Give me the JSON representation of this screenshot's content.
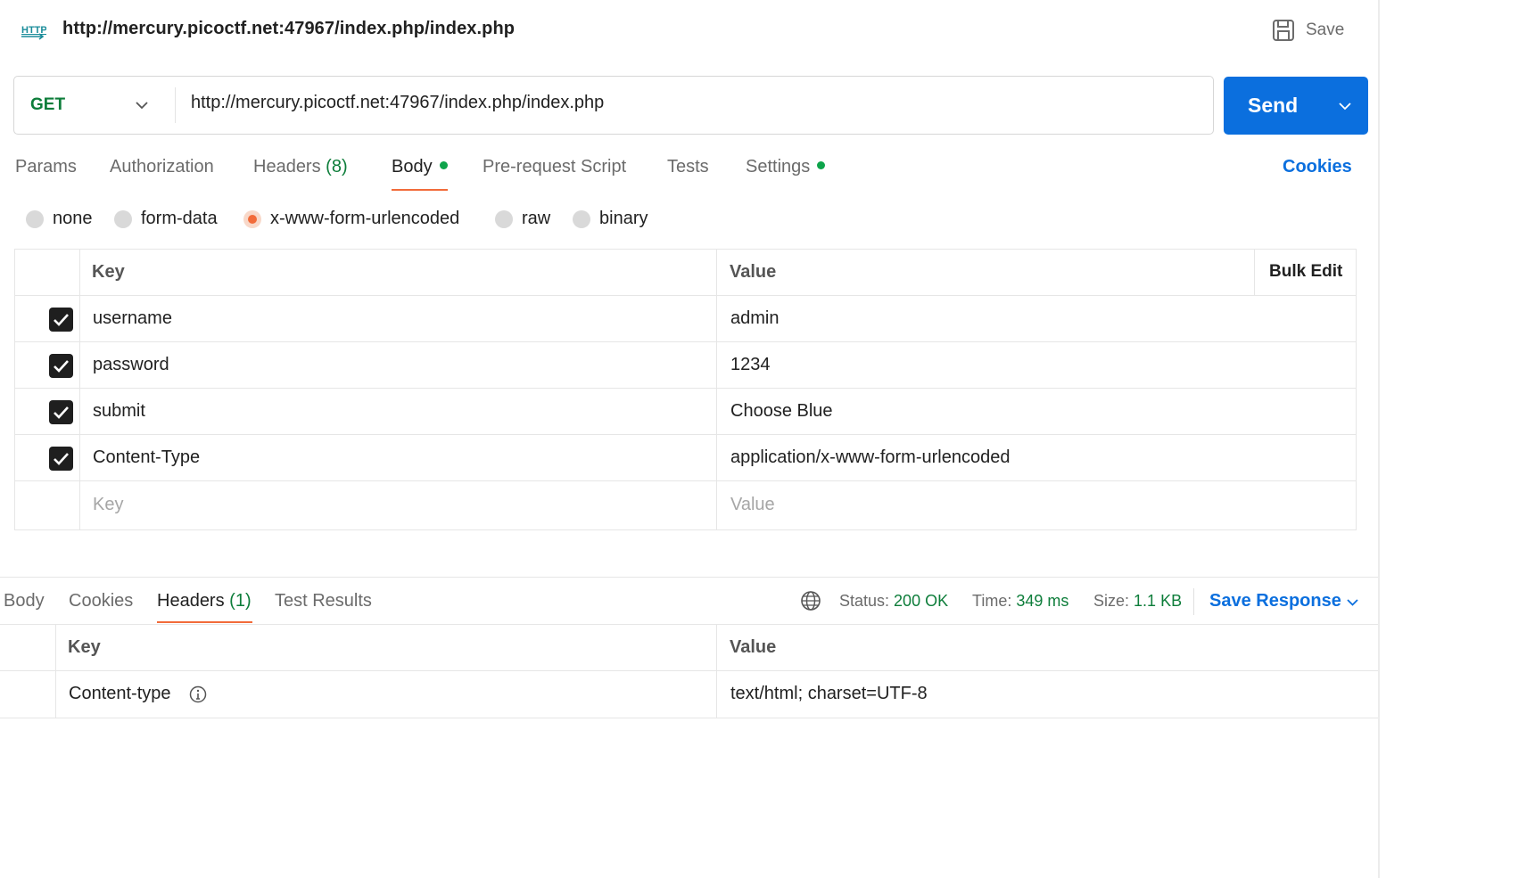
{
  "window": {
    "title": "http://mercury.picoctf.net:47967/index.php/index.php",
    "save_label": "Save"
  },
  "request": {
    "method": "GET",
    "url": "http://mercury.picoctf.net:47967/index.php/index.php",
    "send_label": "Send"
  },
  "tabs": {
    "params": "Params",
    "authorization": "Authorization",
    "headers": "Headers",
    "headers_count": "(8)",
    "body": "Body",
    "prerequest": "Pre-request Script",
    "tests": "Tests",
    "settings": "Settings",
    "cookies": "Cookies"
  },
  "body_types": {
    "none": "none",
    "form_data": "form-data",
    "urlencoded": "x-www-form-urlencoded",
    "raw": "raw",
    "binary": "binary",
    "selected": "x-www-form-urlencoded"
  },
  "params_table": {
    "key_header": "Key",
    "value_header": "Value",
    "bulk_edit": "Bulk Edit",
    "rows": [
      {
        "key": "username",
        "value": "admin",
        "checked": true
      },
      {
        "key": "password",
        "value": "1234",
        "checked": true
      },
      {
        "key": "submit",
        "value": "Choose Blue",
        "checked": true
      },
      {
        "key": "Content-Type",
        "value": "application/x-www-form-urlencoded",
        "checked": true
      }
    ],
    "key_placeholder": "Key",
    "value_placeholder": "Value"
  },
  "response": {
    "tabs": {
      "body": "Body",
      "cookies": "Cookies",
      "headers": "Headers",
      "headers_count": "(1)",
      "test_results": "Test Results"
    },
    "status_label": "Status:",
    "status_value": "200 OK",
    "time_label": "Time:",
    "time_value": "349 ms",
    "size_label": "Size:",
    "size_value": "1.1 KB",
    "save_response": "Save Response",
    "table": {
      "key_header": "Key",
      "value_header": "Value",
      "rows": [
        {
          "key": "Content-type",
          "value": "text/html; charset=UTF-8"
        }
      ]
    }
  },
  "colors": {
    "accent_blue": "#0b6fde",
    "method_green": "#0d7d3a",
    "active_tab_orange": "#f26b3a",
    "status_dot_green": "#0ea44b"
  }
}
